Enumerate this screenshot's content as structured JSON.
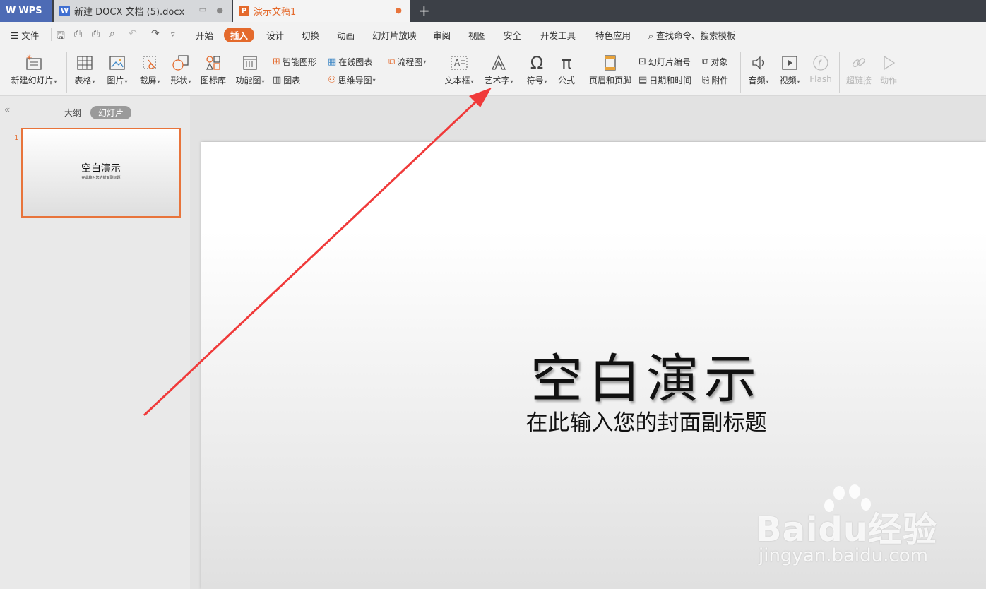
{
  "tabs": {
    "wps": "WPS",
    "docx": "新建 DOCX 文档 (5).docx",
    "ppt": "演示文稿1",
    "new_tab": "+"
  },
  "menu": {
    "file": "文件",
    "items": [
      "开始",
      "插入",
      "设计",
      "切换",
      "动画",
      "幻灯片放映",
      "审阅",
      "视图",
      "安全",
      "开发工具",
      "特色应用"
    ],
    "active": "插入",
    "search": "查找命令、搜索模板"
  },
  "ribbon": {
    "new_slide": "新建幻灯片",
    "table": "表格",
    "picture": "图片",
    "screenshot": "截屏",
    "shape": "形状",
    "icon_lib": "图标库",
    "func_chart": "功能图",
    "smart_shape": "智能图形",
    "online_chart": "在线图表",
    "flowchart": "流程图",
    "chart": "图表",
    "mindmap": "思维导图",
    "textbox": "文本框",
    "wordart": "艺术字",
    "symbol": "符号",
    "formula": "公式",
    "header_footer": "页眉和页脚",
    "slide_number": "幻灯片编号",
    "object": "对象",
    "date_time": "日期和时间",
    "attachment": "附件",
    "audio": "音频",
    "video": "视频",
    "flash": "Flash",
    "hyperlink": "超链接",
    "action": "动作"
  },
  "left_panel": {
    "outline": "大纲",
    "slides": "幻灯片",
    "slide_number": "1",
    "thumb_title": "空白演示",
    "thumb_subtitle": "在此输入您的封面副标题"
  },
  "slide": {
    "title": "空白演示",
    "subtitle": "在此输入您的封面副标题"
  },
  "watermark": {
    "main": "Baidu经验",
    "sub": "jingyan.baidu.com"
  },
  "colors": {
    "accent": "#e46a2c",
    "titlebar": "#3c4047",
    "arrow": "#f03a3a"
  }
}
